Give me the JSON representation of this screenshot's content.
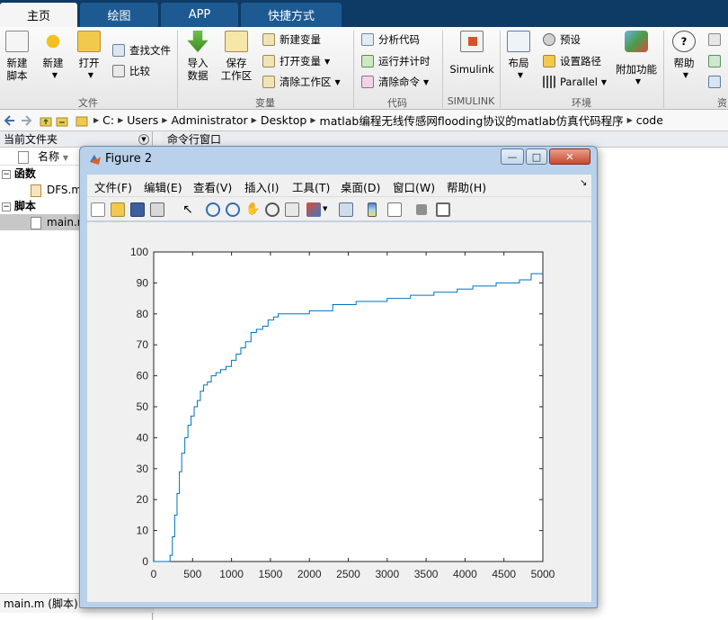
{
  "tabs": [
    "主页",
    "绘图",
    "APP",
    "快捷方式"
  ],
  "ribbon": {
    "file_group": "文件",
    "var_group": "变量",
    "code_group": "代码",
    "simulink_group": "SIMULINK",
    "env_group": "环境",
    "new_script": [
      "新建",
      "脚本"
    ],
    "new": "新建",
    "open": "打开",
    "find_files": "查找文件",
    "compare": "比较",
    "import_data": [
      "导入",
      "数据"
    ],
    "save_workspace": [
      "保存",
      "工作区"
    ],
    "new_variable": "新建变量",
    "open_variable": "打开变量",
    "clear_workspace": "清除工作区",
    "analyze_code": "分析代码",
    "run_and_time": "运行并计时",
    "clear_commands": "清除命令",
    "simulink": "Simulink",
    "layout": "布局",
    "preferences": "预设",
    "set_path": "设置路径",
    "parallel": "Parallel",
    "addons": "附加功能",
    "help": "帮助",
    "resources_partial": "资"
  },
  "address": {
    "crumbs": [
      "C:",
      "Users",
      "Administrator",
      "Desktop",
      "matlab编程无线传感网flooding协议的matlab仿真代码程序",
      "code"
    ]
  },
  "left_panel": {
    "title": "当前文件夹",
    "column_name": "名称",
    "sort_indicator": "▼",
    "group_functions": "函数",
    "file_dfs": "DFS.m",
    "group_scripts": "脚本",
    "file_main": "main.m",
    "status": "main.m  (脚本)"
  },
  "command_window": {
    "title": "命令行窗口"
  },
  "figure": {
    "title": "Figure 2",
    "menus": [
      "文件(F)",
      "编辑(E)",
      "查看(V)",
      "插入(I)",
      "工具(T)",
      "桌面(D)",
      "窗口(W)",
      "帮助(H)"
    ],
    "dock_arrow": "↘"
  },
  "colors": {
    "tab_bar": "#0d3b66",
    "tab": "#1d5a92",
    "line": "#0072bd"
  },
  "chart_data": {
    "type": "line",
    "xlim": [
      0,
      5000
    ],
    "ylim": [
      0,
      100
    ],
    "xticks": [
      0,
      500,
      1000,
      1500,
      2000,
      2500,
      3000,
      3500,
      4000,
      4500,
      5000
    ],
    "yticks": [
      0,
      10,
      20,
      30,
      40,
      50,
      60,
      70,
      80,
      90,
      100
    ],
    "grid": false,
    "series": [
      {
        "x": [
          0,
          190,
          210,
          240,
          270,
          300,
          330,
          360,
          400,
          440,
          480,
          520,
          560,
          600,
          640,
          690,
          740,
          800,
          860,
          930,
          1000,
          1060,
          1120,
          1180,
          1250,
          1320,
          1400,
          1470,
          1540,
          1600,
          1800,
          2000,
          2300,
          2600,
          3000,
          3300,
          3600,
          3900,
          4100,
          4400,
          4700,
          4850,
          5000
        ],
        "y": [
          0,
          0,
          2,
          8,
          15,
          22,
          29,
          35,
          40,
          44,
          47,
          50,
          52,
          55,
          57,
          58,
          60,
          61,
          62,
          63,
          65,
          67,
          69,
          71,
          74,
          75,
          76,
          78,
          79,
          80,
          80,
          81,
          83,
          84,
          85,
          86,
          87,
          88,
          89,
          90,
          91,
          93,
          93
        ]
      }
    ]
  }
}
